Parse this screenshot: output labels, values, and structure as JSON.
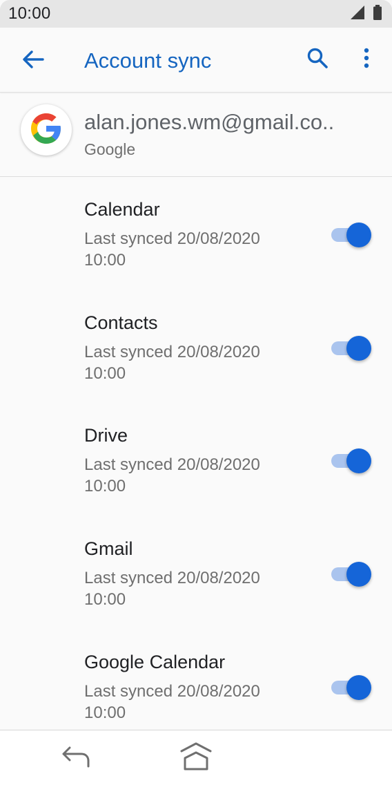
{
  "status_bar": {
    "time": "10:00",
    "icons": [
      "signal-icon",
      "battery-icon"
    ]
  },
  "app_bar": {
    "title": "Account sync",
    "icons": [
      "back-arrow-icon",
      "search-icon",
      "more-vert-icon"
    ]
  },
  "account": {
    "email": "alan.jones.wm@gmail.co..",
    "provider": "Google",
    "avatar_icon": "google-logo-icon"
  },
  "sync_items": [
    {
      "title": "Calendar",
      "status": "Last synced 20/08/2020 10:00",
      "enabled": true
    },
    {
      "title": "Contacts",
      "status": "Last synced 20/08/2020 10:00",
      "enabled": true
    },
    {
      "title": "Drive",
      "status": "Last synced 20/08/2020 10:00",
      "enabled": true
    },
    {
      "title": "Gmail",
      "status": "Last synced 20/08/2020 10:00",
      "enabled": true
    },
    {
      "title": "Google Calendar",
      "status": "Last synced 20/08/2020 10:00",
      "enabled": true
    }
  ],
  "nav_bar": {
    "icons": [
      "nav-back-icon",
      "nav-home-icon"
    ]
  },
  "colors": {
    "accent": "#1565c0",
    "toggle_thumb": "#1565d8",
    "toggle_track": "#aac4ee",
    "status_bar_bg": "#e6e6e6"
  }
}
